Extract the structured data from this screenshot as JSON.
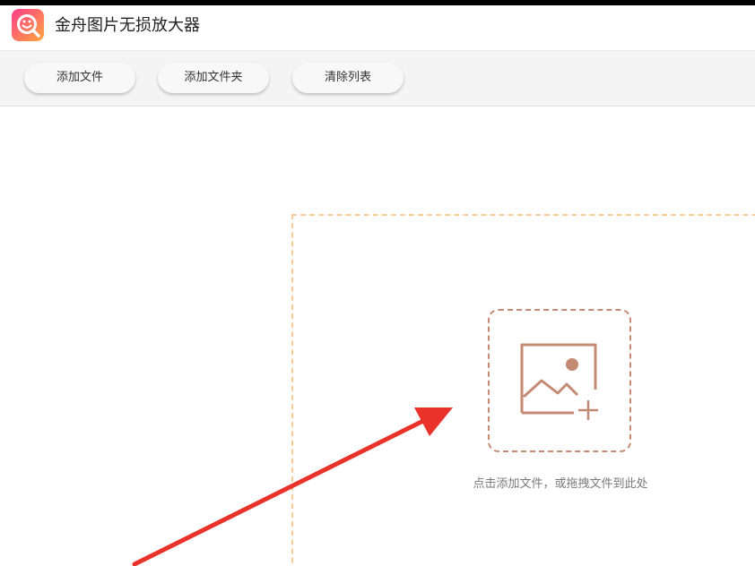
{
  "window": {
    "title": "金舟图片无损放大器",
    "logo_icon": "magnifier-app-logo-icon"
  },
  "toolbar": {
    "add_file_label": "添加文件",
    "add_folder_label": "添加文件夹",
    "clear_list_label": "清除列表"
  },
  "dropzone": {
    "hint": "点击添加文件，或拖拽文件到此处",
    "icon": "image-add-icon"
  },
  "annotation": {
    "icon": "red-arrow-icon",
    "color": "#e8322a"
  },
  "colors": {
    "accent": "#c58a74",
    "dropzone_border": "#fbcb96",
    "logo_gradient_start": "#ff4f7a",
    "logo_gradient_end": "#ffa63d"
  }
}
